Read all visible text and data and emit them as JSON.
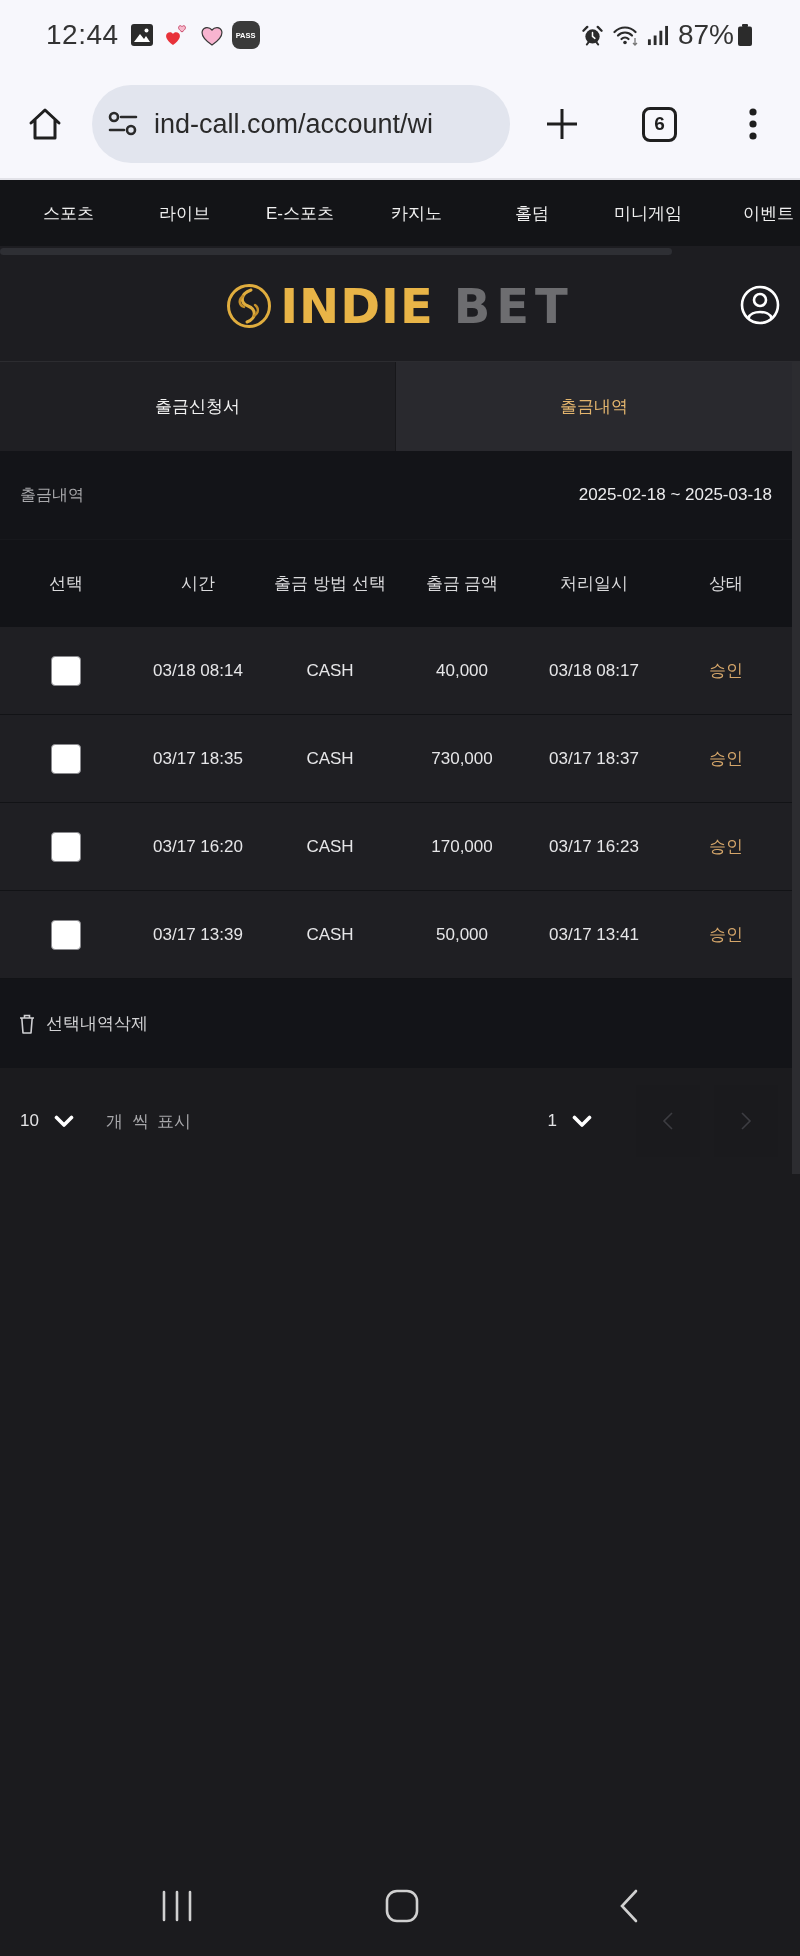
{
  "status_bar": {
    "time": "12:44",
    "badge": "PASS",
    "battery": "87%"
  },
  "browser": {
    "url": "ind-call.com/account/wi",
    "tab_count": "6"
  },
  "nav": {
    "items": [
      "스포츠",
      "라이브",
      "E-스포츠",
      "카지노",
      "홀덤",
      "미니게임",
      "이벤트"
    ]
  },
  "logo": {
    "words": [
      "INDIE",
      "BET"
    ]
  },
  "tabs": [
    {
      "label": "출금신청서",
      "selected": false
    },
    {
      "label": "출금내역",
      "selected": true
    }
  ],
  "summary": {
    "title": "출금내역",
    "date_range": "2025-02-18 ~ 2025-03-18"
  },
  "table": {
    "columns": [
      "선택",
      "시간",
      "출금 방법 선택",
      "출금 금액",
      "처리일시",
      "상태"
    ],
    "rows": [
      {
        "checked": false,
        "time": "03/18 08:14",
        "method": "CASH",
        "amount": "40,000",
        "processed": "03/18 08:17",
        "status": "승인"
      },
      {
        "checked": false,
        "time": "03/17 18:35",
        "method": "CASH",
        "amount": "730,000",
        "processed": "03/17 18:37",
        "status": "승인"
      },
      {
        "checked": false,
        "time": "03/17 16:20",
        "method": "CASH",
        "amount": "170,000",
        "processed": "03/17 16:23",
        "status": "승인"
      },
      {
        "checked": false,
        "time": "03/17 13:39",
        "method": "CASH",
        "amount": "50,000",
        "processed": "03/17 13:41",
        "status": "승인"
      }
    ]
  },
  "delete_button": {
    "label": "선택내역삭제"
  },
  "pagination": {
    "page_size": "10",
    "page_size_label": "개 씩 표시",
    "page": "1",
    "prev": {
      "disabled": true
    },
    "next": {
      "disabled": true
    }
  }
}
